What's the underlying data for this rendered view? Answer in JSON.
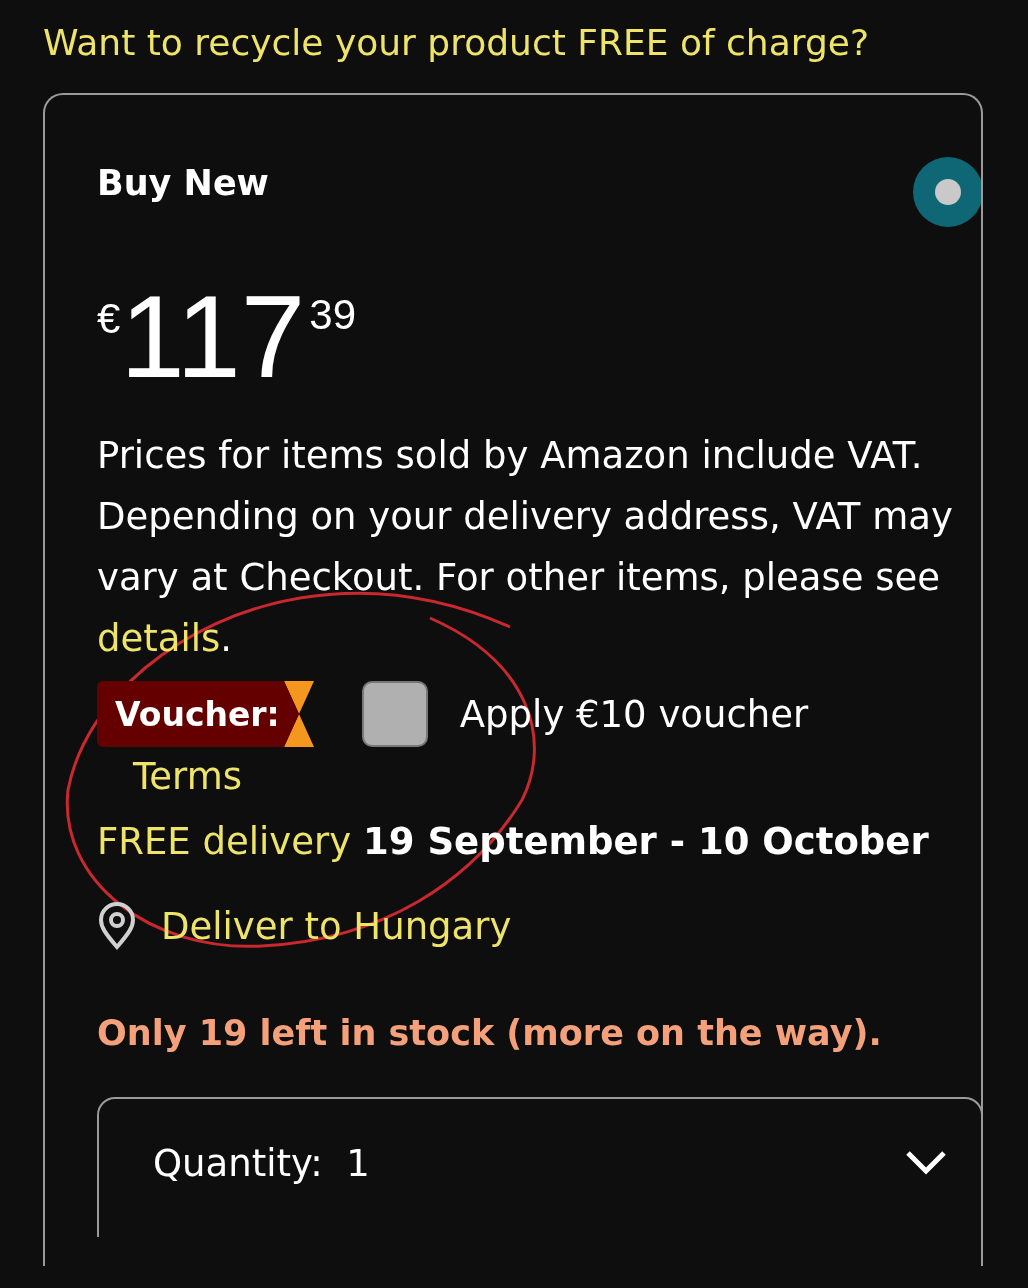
{
  "promo_link": "Want to recycle your product FREE of charge?",
  "offer": {
    "title": "Buy New",
    "selected": true,
    "price": {
      "currency": "€",
      "whole": "117",
      "fraction": "39"
    },
    "vat_note": {
      "text": "Prices for items sold by Amazon include VAT. Depending on your delivery address, VAT may vary at Checkout. For other items, please see",
      "link": "details",
      "end": "."
    },
    "voucher": {
      "badge": "Voucher:",
      "checked": false,
      "label": "Apply €10 voucher",
      "terms": "Terms"
    },
    "delivery": {
      "link": "FREE delivery",
      "dates": "19 September - 10 October"
    },
    "location": "Deliver to Hungary",
    "stock": "Only 19 left in stock (more on the way).",
    "quantity": {
      "label": "Quantity:",
      "value": "1"
    }
  },
  "annotation": {
    "kind": "circle"
  }
}
